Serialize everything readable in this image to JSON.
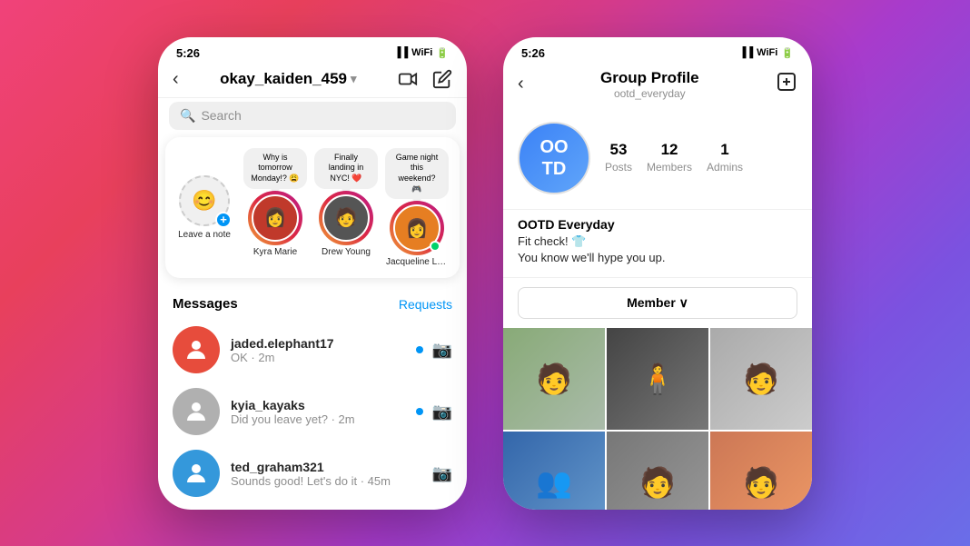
{
  "left_phone": {
    "status_bar": {
      "time": "5:26",
      "icons": "▐▐ ᵂ ▮▮"
    },
    "nav": {
      "title": "okay_kaiden_459",
      "back": "‹",
      "dropdown": "›",
      "video_icon": "⬜",
      "edit_icon": "✏"
    },
    "search_placeholder": "Search",
    "stories": [
      {
        "id": "leave_note",
        "label": "Leave a note",
        "avatar_emoji": "😊",
        "has_plus": true,
        "note": null
      },
      {
        "id": "kyra_marie",
        "label": "Kyra Marie",
        "note": "Why is tomorrow Monday!? 😩",
        "avatar_color": "#e74c3c",
        "avatar_emoji": "👩",
        "online": false
      },
      {
        "id": "drew_young",
        "label": "Drew Young",
        "note": "Finally landing in NYC! ❤️",
        "avatar_color": "#555",
        "avatar_emoji": "🧑",
        "online": false
      },
      {
        "id": "jacqueline_lam",
        "label": "Jacqueline Lam",
        "note": "Game night this weekend? 🎮",
        "avatar_color": "#e67e22",
        "avatar_emoji": "👩",
        "online": true
      }
    ],
    "messages_title": "Messages",
    "requests_label": "Requests",
    "messages": [
      {
        "username": "jaded.elephant17",
        "preview": "OK · 2m",
        "unread": true,
        "avatar_color": "#c0392b",
        "avatar_emoji": "👤"
      },
      {
        "username": "kyia_kayaks",
        "preview": "Did you leave yet? · 2m",
        "unread": true,
        "avatar_color": "#8e8e8e",
        "avatar_emoji": "👤"
      },
      {
        "username": "ted_graham321",
        "preview": "Sounds good! Let's do it · 45m",
        "unread": false,
        "avatar_color": "#3498db",
        "avatar_emoji": "👤"
      }
    ]
  },
  "right_phone": {
    "status_bar": {
      "time": "5:26",
      "icons": "▐▐ ᵂ ▮▮"
    },
    "nav": {
      "title": "Group Profile",
      "subtitle": "ootd_everyday",
      "back": "‹",
      "add_icon": "⊕"
    },
    "group": {
      "avatar_text": "OO\nTD",
      "stats": [
        {
          "number": "53",
          "label": "Posts"
        },
        {
          "number": "12",
          "label": "Members"
        },
        {
          "number": "1",
          "label": "Admins"
        }
      ],
      "name": "OOTD Everyday",
      "bio_line1": "Fit check! 👕",
      "bio_line2": "You know we'll hype you up.",
      "member_button": "Member ∨"
    },
    "photos": [
      {
        "color": "#7cb87c",
        "emoji": "🧑"
      },
      {
        "color": "#555",
        "emoji": "🧍"
      },
      {
        "color": "#c0c0c0",
        "emoji": "🧑"
      },
      {
        "color": "#4488cc",
        "emoji": "👥"
      },
      {
        "color": "#888",
        "emoji": "🧑"
      },
      {
        "color": "#dd8866",
        "emoji": "🧑"
      }
    ]
  }
}
